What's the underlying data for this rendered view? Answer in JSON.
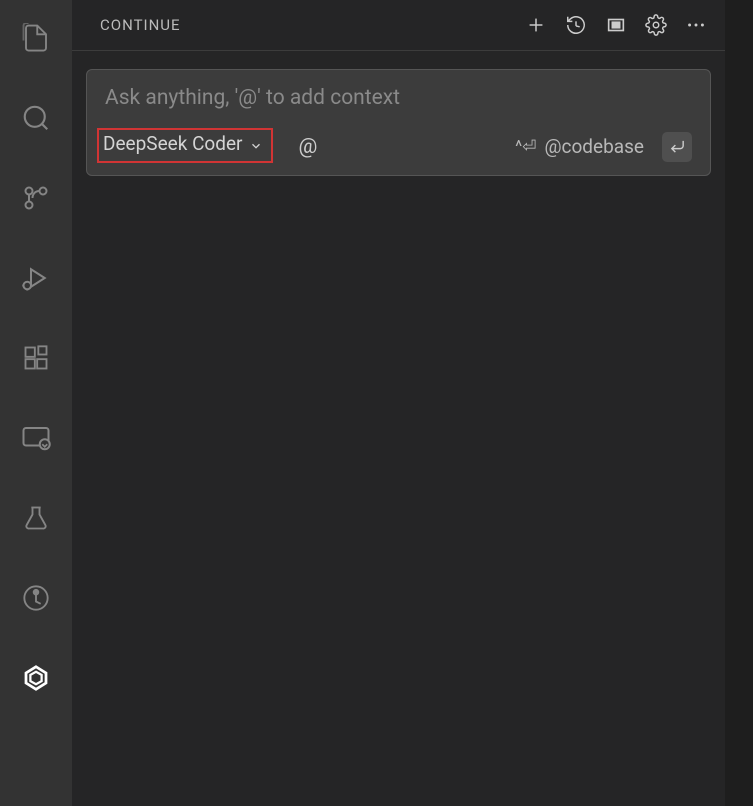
{
  "panel": {
    "title": "CONTINUE"
  },
  "chat": {
    "placeholder": "Ask anything, '@' to add context",
    "model": "DeepSeek Coder",
    "at_symbol": "@",
    "shortcut": "^⏎",
    "codebase_label": "@codebase"
  }
}
